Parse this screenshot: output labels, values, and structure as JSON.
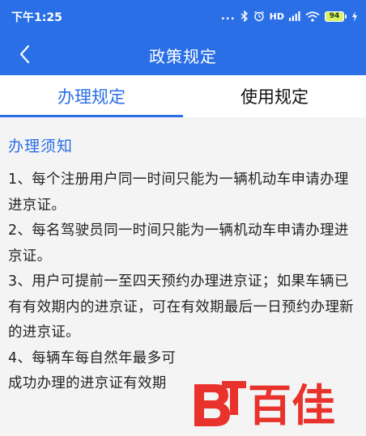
{
  "status_bar": {
    "time": "下午1:25",
    "dots": "...",
    "signal_label": "HD",
    "battery": "94"
  },
  "nav": {
    "title": "政策规定"
  },
  "tabs": [
    {
      "label": "办理规定",
      "active": true
    },
    {
      "label": "使用规定",
      "active": false
    }
  ],
  "content": {
    "section_title": "办理须知",
    "rules": [
      "1、每个注册用户同一时间只能为一辆机动车申请办理进京证。",
      "2、每名驾驶员同一时间只能为一辆机动车申请办理进京证。",
      "3、用户可提前一至四天预约办理进京证；如果车辆已有有效期内的进京证，可在有效期最后一日预约办理新的进京证。",
      "4、每辆车每自然年最多可",
      "成功办理的进京证有效期"
    ]
  },
  "watermark": {
    "text": "百佳"
  },
  "colors": {
    "primary": "#2b6fe6",
    "background": "#f4f4f4",
    "watermark_red": "#e8322b"
  }
}
